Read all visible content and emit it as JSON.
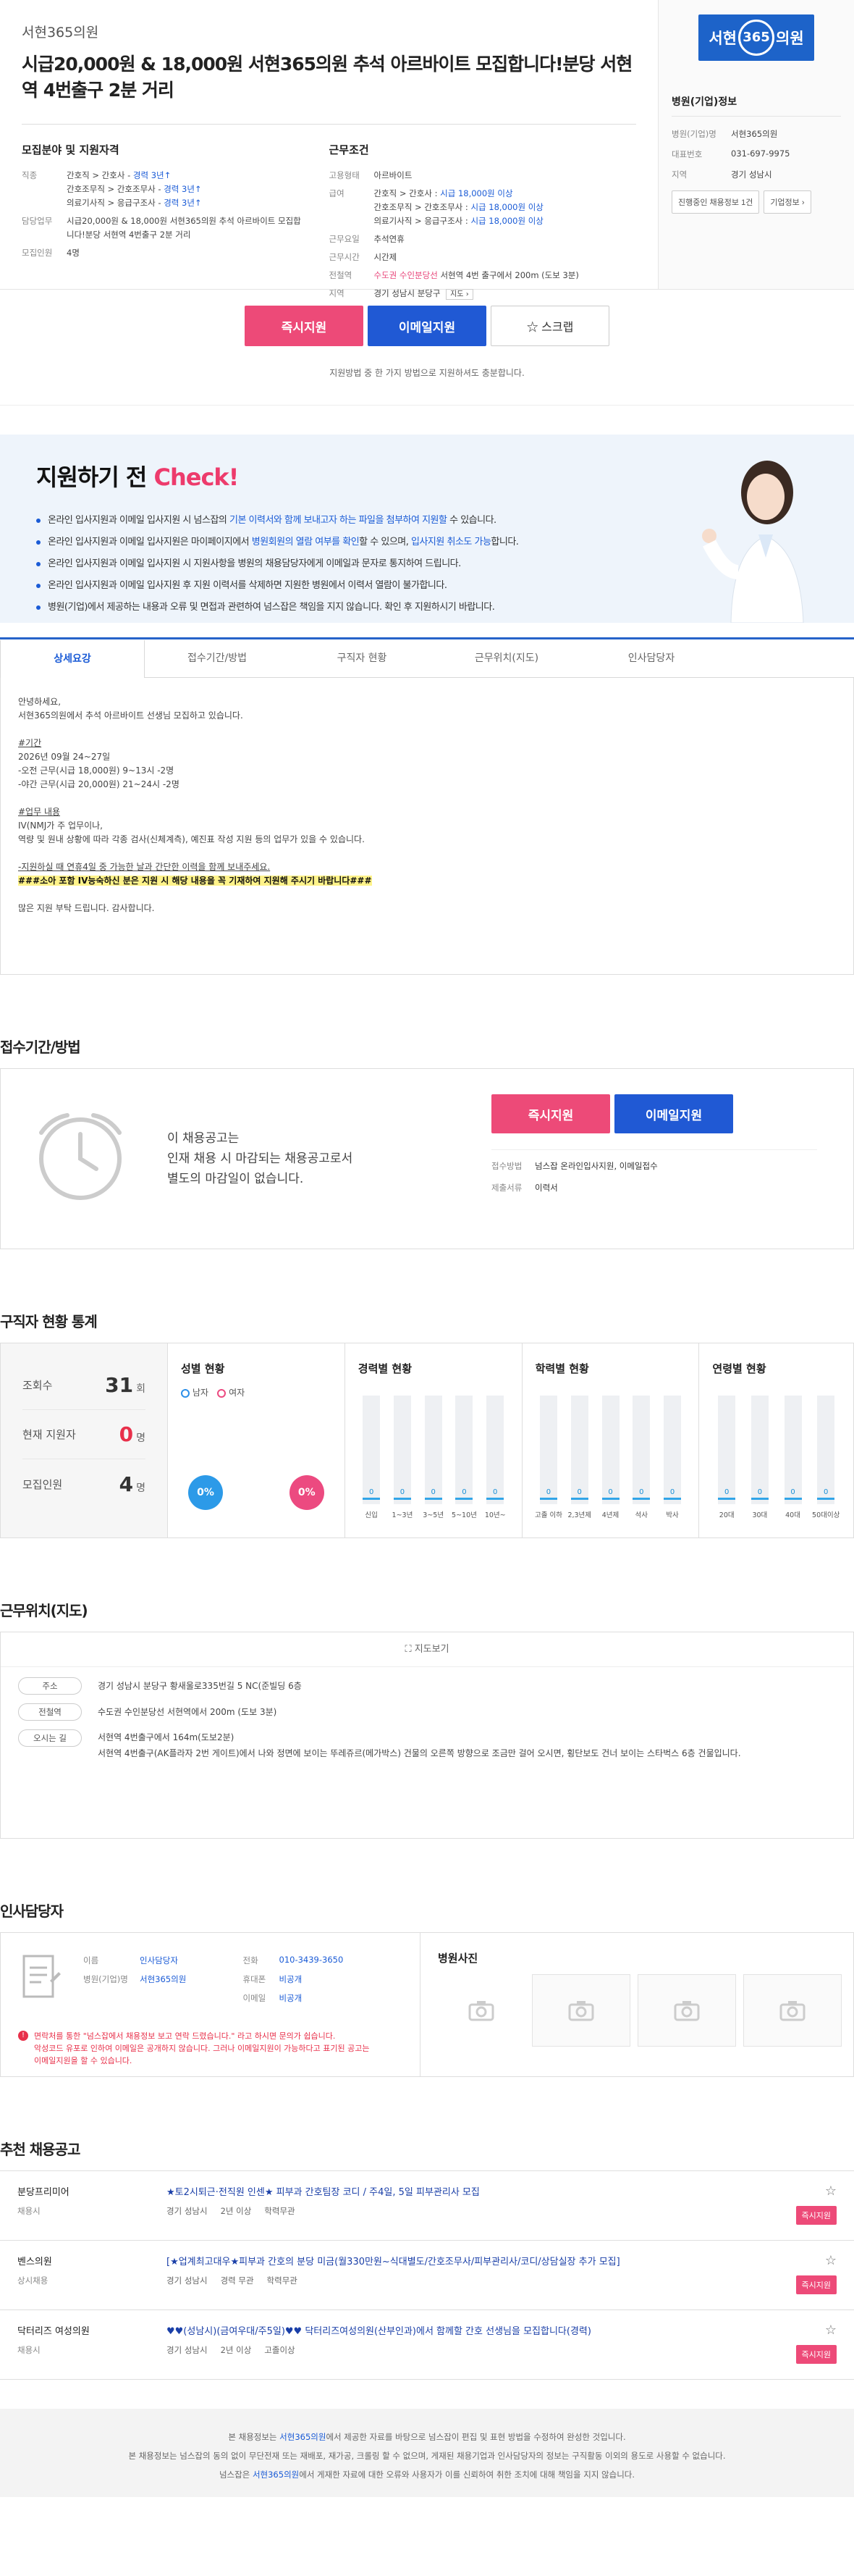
{
  "header": {
    "company": "서현365의원",
    "title": "시급20,000원 & 18,000원 서현365의원 추석 아르바이트 모집합니다!분당 서현역 4번출구 2분 거리"
  },
  "recruit": {
    "heading": "모집분야 및 지원자격",
    "rows": [
      {
        "k": "직종",
        "lines": [
          [
            "간호직 > 간호사 - ",
            "경력 3년↑"
          ],
          [
            "간호조무직 > 간호조무사 - ",
            "경력 3년↑"
          ],
          [
            "의료기사직 > 응급구조사 - ",
            "경력 3년↑"
          ]
        ]
      },
      {
        "k": "담당업무",
        "lines": [
          [
            "시급20,000원 & 18,000원 서현365의원 추석 아르바이트 모집합",
            ""
          ],
          [
            "니다!분당 서현역 4번출구 2분 거리",
            ""
          ]
        ]
      },
      {
        "k": "모집인원",
        "lines": [
          [
            "4명",
            ""
          ]
        ]
      }
    ]
  },
  "conditions": {
    "heading": "근무조건",
    "employ_k": "고용형태",
    "employ_v": "아르바이트",
    "pay_k": "급여",
    "pay_lines": [
      [
        "간호직 > 간호사 : ",
        "시급 18,000원 이상"
      ],
      [
        "간호조무직 > 간호조무사 : ",
        "시급 18,000원 이상"
      ],
      [
        "의료기사직 > 응급구조사 : ",
        "시급 18,000원 이상"
      ]
    ],
    "days_k": "근무요일",
    "days_v": "추석연휴",
    "time_k": "근무시간",
    "time_v": "시간제",
    "subway_k": "전철역",
    "subway_red": "수도권 수인분당선",
    "subway_rest": " 서현역 4번 출구에서 200m (도보 3분)",
    "area_k": "지역",
    "area_v": "경기 성남시 분당구",
    "area_map": "지도 ›"
  },
  "sidebar": {
    "logo_left": "서현",
    "logo_num": "365",
    "logo_right": "의원",
    "title": "병원(기업)정보",
    "rows": [
      {
        "k": "병원(기업)명",
        "v": "서현365의원"
      },
      {
        "k": "대표번호",
        "v": "031-697-9975"
      },
      {
        "k": "지역",
        "v": "경기 성남시"
      }
    ],
    "btn_jobs": "진행중인 채용정보 1건",
    "btn_info": "기업정보 ›"
  },
  "apply": {
    "apply_label": "즉시지원",
    "email_label": "이메일지원",
    "scrap_label": "☆ 스크랩",
    "note": "지원방법 중 한 가지 방법으로 지원하셔도 충분합니다."
  },
  "check": {
    "title_a": "지원하기 전 ",
    "title_b": "Check!",
    "items": [
      [
        "온라인 입사지원과 이메일 입사지원 시 넘스잡의 ",
        "기본 이력서와 함께 보내고자 하는 파일을 첨부하여 지원할",
        " 수 있습니다."
      ],
      [
        "온라인 입사지원과 이메일 입사지원은 마이페이지에서 ",
        "병원회원의 열람 여부를 확인",
        "할 수 있으며, ",
        "입사지원 취소도 가능",
        "합니다."
      ],
      [
        "온라인 입사지원과 이메일 입사지원 시 지원사항을 병원의 채용담당자에게 이메일과 문자로 통지하여 드립니다.",
        "",
        ""
      ],
      [
        "온라인 입사지원과 이메일 입사지원 후 지원 이력서를 삭제하면 지원한 병원에서 이력서 열람이 불가합니다.",
        "",
        ""
      ],
      [
        "병원(기업)에서 제공하는 내용과 오류 및 면접과 관련하여 넘스잡은 책임을 지지 않습니다. 확인 후 지원하시기 바랍니다.",
        "",
        ""
      ]
    ]
  },
  "tabs": [
    "상세요강",
    "접수기간/방법",
    "구직자 현황",
    "근무위치(지도)",
    "인사담당자"
  ],
  "detail": {
    "l1": "안녕하세요,",
    "l2": "서현365의원에서 추석 아르바이트 선생님 모집하고 있습니다.",
    "l3": "#기간",
    "l4": " 2026년 09월 24~27일",
    "l5": "-오전 근무(시급 18,000원) 9~13시 -2명",
    "l6": "-야간 근무(시급 20,000원) 21~24시 -2명",
    "l7": "#업무 내용",
    "l8": "IV(NMJ가 주 업무이나,",
    "l9": "역량 및 원내 상황에 따라 각종 검사(신체계측), 예진표 작성 지원 등의 업무가 있을 수 있습니다.",
    "l10": "-지원하실 때 연휴4일 중 가능한 날과 간단한 이력을 함께 보내주세요.",
    "l11": "###소아 포함 IV능숙하신 분은 지원 시 해당 내용을 꼭 기재하여 지원해 주시기 바랍니다###",
    "l12": "많은 지원 부탁 드립니다. 감사합니다."
  },
  "receipt": {
    "title": "접수기간/방법",
    "msg1": "이 채용공고는",
    "msg2": "인재 채용 시 마감되는 채용공고로서",
    "msg3": "별도의 마감일이 없습니다.",
    "method_k": "접수방법",
    "method_v": "넘스잡 온라인입사지원, 이메일접수",
    "docs_k": "제출서류",
    "docs_v": "이력서"
  },
  "stats": {
    "title": "구직자 현황 통계",
    "views_k": "조회수",
    "views_v": "31",
    "views_u": "회",
    "applicants_k": "현재 지원자",
    "applicants_v": "0",
    "applicants_u": "명",
    "hire_k": "모집인원",
    "hire_v": "4",
    "hire_u": "명",
    "gender_title": "성별 현황",
    "male": "남자",
    "female": "여자",
    "male_pct": "0%",
    "female_pct": "0%",
    "career_title": "경력별 현황",
    "career": [
      {
        "label": "신입",
        "value": "0"
      },
      {
        "label": "1~3년",
        "value": "0"
      },
      {
        "label": "3~5년",
        "value": "0"
      },
      {
        "label": "5~10년",
        "value": "0"
      },
      {
        "label": "10년~",
        "value": "0"
      }
    ],
    "edu_title": "학력별 현황",
    "edu": [
      {
        "label": "고졸 이하",
        "value": "0"
      },
      {
        "label": "2,3년제",
        "value": "0"
      },
      {
        "label": "4년제",
        "value": "0"
      },
      {
        "label": "석사",
        "value": "0"
      },
      {
        "label": "박사",
        "value": "0"
      }
    ],
    "age_title": "연령별 현황",
    "age": [
      {
        "label": "20대",
        "value": "0"
      },
      {
        "label": "30대",
        "value": "0"
      },
      {
        "label": "40대",
        "value": "0"
      },
      {
        "label": "50대이상",
        "value": "0"
      }
    ],
    "colors": {
      "male": "#2c9ae8",
      "female": "#ec4a80",
      "bar": "#32a5e8"
    }
  },
  "location": {
    "title": "근무위치(지도)",
    "map_btn": "지도보기",
    "addr_k": "주소",
    "addr_v": "경기 성남시 분당구 황새울로335번길 5 NC(준빌딩 6층",
    "subway_k": "전철역",
    "subway_v": "수도권 수인분당선 서현역에서 200m (도보 3분)",
    "way_k": "오시는 길",
    "way_v1": "서현역 4번출구에서 164m(도보2분)",
    "way_v2": "서현역 4번출구(AK플라자 2번 게이트)에서 나와 정면에 보이는 뚜레쥬르(메가박스) 건물의 오른쪽 방향으로 조금만 걸어 오시면, 횡단보도 건너 보이는 스타벅스 6층 건물입니다."
  },
  "contact": {
    "title": "인사담당자",
    "name_k": "이름",
    "name_v": "인사담당자",
    "dept_k": "병원(기업)명",
    "dept_v": "서현365의원",
    "phone_k": "전화",
    "phone_v": "010-3439-3650",
    "mobile_k": "휴대폰",
    "mobile_v": "비공개",
    "email_k": "이메일",
    "email_v": "비공개",
    "warn1": "면락처를 통한 \"넘스잡에서 채용정보 보고 연락 드렸습니다.\" 라고 하시면 문의가 쉽습니다.",
    "warn2": "악성코드 유포로 인하여 이메일은 공개하지 않습니다. 그러나 이메일지원이 가능하다고 표기된 공고는",
    "warn3": "이메일지원을 할 수 있습니다.",
    "photos_title": "병원사진"
  },
  "recommend": {
    "title": "추천 채용공고",
    "items": [
      {
        "company": "분당프리미어",
        "type": "채용시",
        "title": "★토2시퇴근·전직원 인센★ 피부과 간호팀장 코디 / 주4일, 5일 피부관리사 모집",
        "m1": "경기 성남시",
        "m2": "2년 이상",
        "m3": "학력무관",
        "apply": "즉시지원"
      },
      {
        "company": "벤스의원",
        "type": "상시채용",
        "title": "[★업계최고대우★피부과 간호의 분당 미금(월330만원~식대별도/간호조무사/피부관리사/코디/상담실장 추가 모집]",
        "m1": "경기 성남시",
        "m2": "경력 무관",
        "m3": "학력무관",
        "apply": "즉시지원"
      },
      {
        "company": "닥터리즈 여성의원",
        "type": "채용시",
        "title": "♥♥(성남시)(금여우대/주5일)♥♥ 닥터리즈여성의원(산부인과)에서 함께할 간호 선생님을 모집합니다(경력)",
        "m1": "경기 성남시",
        "m2": "2년 이상",
        "m3": "고졸이상",
        "apply": "즉시지원"
      }
    ]
  },
  "footer": {
    "l1a": "본 채용정보는 ",
    "l1b": "서현365의원",
    "l1c": "에서 제공한 자료를 바탕으로 넘스잡이 편집 및 표현 방법을 수정하여 완성한 것입니다.",
    "l2": "본 채용정보는 넘스잡의 동의 없이 무단전재 또는 재배포, 재가공, 크롤링 할 수 없으며, 게재된 채용기업과 인사담당자의 정보는 구직활동 이외의 용도로 사용할 수 없습니다.",
    "l3a": "넘스잡은 ",
    "l3b": "서현365의원",
    "l3c": "에서 게재한 자료에 대한 오류와 사용자가 이를 신뢰하여 취한 조치에 대해 책임을 지지 않습니다."
  }
}
